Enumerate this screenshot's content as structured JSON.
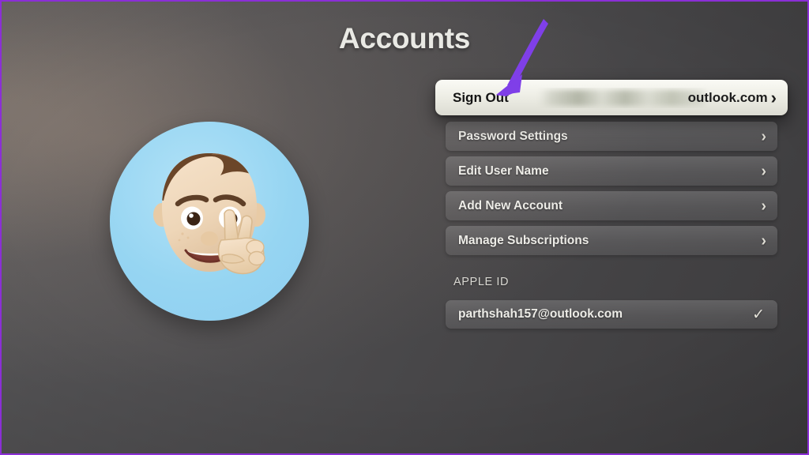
{
  "screen": {
    "title": "Accounts",
    "platform_surface": "apple-tv-settings-accounts"
  },
  "avatar": {
    "name": "memoji-avatar",
    "description": "Memoji of smiling person with brown hair making a peace sign",
    "circle_color": "#96d5f2",
    "skin_color": "#f0d7bb",
    "hair_color": "#7a5236"
  },
  "menu": {
    "rows": [
      {
        "label": "Sign Out",
        "focused": true,
        "detail_visible": "outlook.com",
        "detail_redacted": true,
        "accessory": "chevron-right-icon"
      },
      {
        "label": "Password Settings",
        "focused": false,
        "accessory": "chevron-right-icon"
      },
      {
        "label": "Edit User Name",
        "focused": false,
        "accessory": "chevron-right-icon"
      },
      {
        "label": "Add New Account",
        "focused": false,
        "accessory": "chevron-right-icon"
      },
      {
        "label": "Manage Subscriptions",
        "focused": false,
        "accessory": "chevron-right-icon"
      }
    ],
    "chevron_glyph": "›"
  },
  "apple_id": {
    "section_label": "APPLE ID",
    "account": "parthshah157@outlook.com",
    "selected": true,
    "check_glyph": "✓"
  },
  "annotation": {
    "arrow_color": "#7f3fe8",
    "arrow_target": "Sign Out",
    "frame_color": "#8B2FD6"
  },
  "colors": {
    "background_dark": "#4a494b",
    "background_light": "#5d5c5e",
    "row_text": "#edece7",
    "focused_row_bg": "#f0f0e8",
    "focused_row_text": "#141414",
    "avatar_blue": "#96d5f2"
  }
}
